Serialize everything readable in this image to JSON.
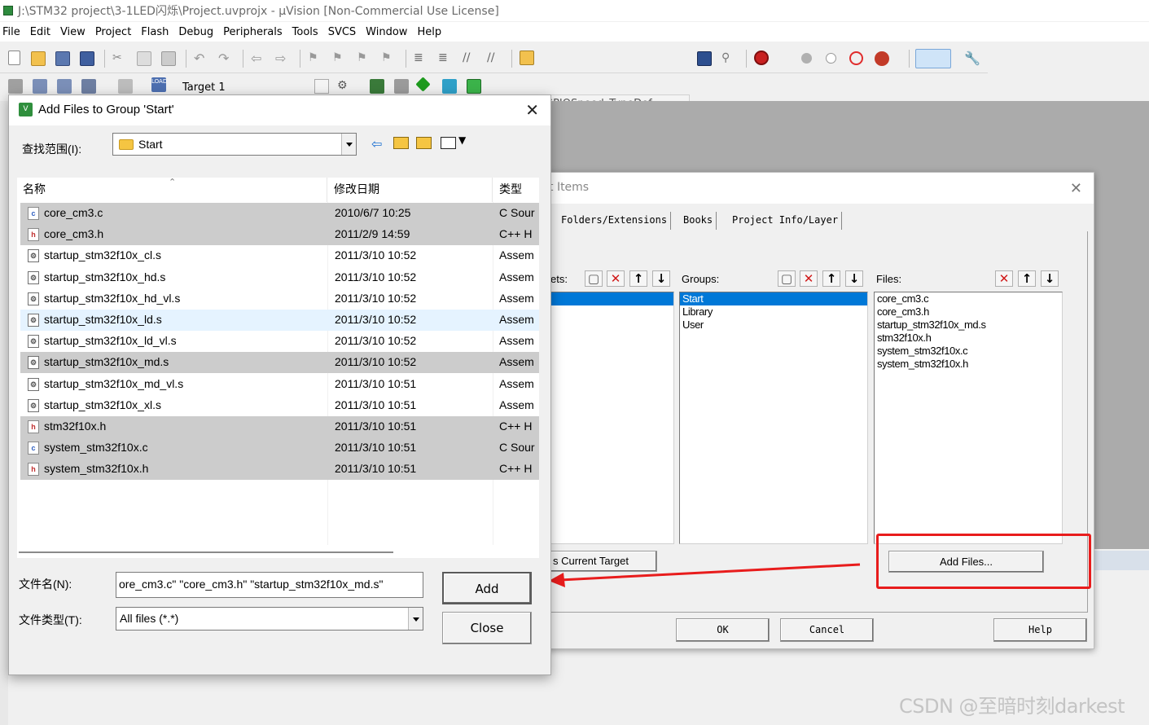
{
  "window": {
    "title": "J:\\STM32 project\\3-1LED闪烁\\Project.uvprojx - µVision  [Non-Commercial Use License]"
  },
  "menu": [
    "File",
    "Edit",
    "View",
    "Project",
    "Flash",
    "Debug",
    "Peripherals",
    "Tools",
    "SVCS",
    "Window",
    "Help"
  ],
  "toolbar": {
    "search_combo_value": "GPIOSpeed_TypeDef",
    "target_value": "Target 1"
  },
  "manage_dialog": {
    "title_fragment": "t Items",
    "tabs": [
      "Folders/Extensions",
      "Books",
      "Project Info/Layer"
    ],
    "targets_label": "ets:",
    "groups_label": "Groups:",
    "files_label": "Files:",
    "groups": [
      {
        "name": "Start",
        "selected": true
      },
      {
        "name": "Library",
        "selected": false
      },
      {
        "name": "User",
        "selected": false
      }
    ],
    "files": [
      "core_cm3.c",
      "core_cm3.h",
      "startup_stm32f10x_md.s",
      "stm32f10x.h",
      "system_stm32f10x.c",
      "system_stm32f10x.h"
    ],
    "set_current_target_label": "s Current Target",
    "add_files_label": "Add Files...",
    "ok_label": "OK",
    "cancel_label": "Cancel",
    "help_label": "Help",
    "highlight_color": "#e81c1c"
  },
  "add_dialog": {
    "title": "Add Files to Group 'Start'",
    "look_in_label": "查找范围(I):",
    "look_in_value": "Start",
    "columns": {
      "name": "名称",
      "date": "修改日期",
      "type": "类型"
    },
    "files": [
      {
        "name": "core_cm3.c",
        "date": "2010/6/7 10:25",
        "type": "C Sour",
        "icon": "c",
        "state": "selected"
      },
      {
        "name": "core_cm3.h",
        "date": "2011/2/9 14:59",
        "type": "C++ H",
        "icon": "h",
        "state": "selected"
      },
      {
        "name": "startup_stm32f10x_cl.s",
        "date": "2011/3/10 10:52",
        "type": "Assem",
        "icon": "asm",
        "state": "none"
      },
      {
        "name": "startup_stm32f10x_hd.s",
        "date": "2011/3/10 10:52",
        "type": "Assem",
        "icon": "asm",
        "state": "none"
      },
      {
        "name": "startup_stm32f10x_hd_vl.s",
        "date": "2011/3/10 10:52",
        "type": "Assem",
        "icon": "asm",
        "state": "none"
      },
      {
        "name": "startup_stm32f10x_ld.s",
        "date": "2011/3/10 10:52",
        "type": "Assem",
        "icon": "asm",
        "state": "hover"
      },
      {
        "name": "startup_stm32f10x_ld_vl.s",
        "date": "2011/3/10 10:52",
        "type": "Assem",
        "icon": "asm",
        "state": "none"
      },
      {
        "name": "startup_stm32f10x_md.s",
        "date": "2011/3/10 10:52",
        "type": "Assem",
        "icon": "asm",
        "state": "selected"
      },
      {
        "name": "startup_stm32f10x_md_vl.s",
        "date": "2011/3/10 10:51",
        "type": "Assem",
        "icon": "asm",
        "state": "none"
      },
      {
        "name": "startup_stm32f10x_xl.s",
        "date": "2011/3/10 10:51",
        "type": "Assem",
        "icon": "asm",
        "state": "none"
      },
      {
        "name": "stm32f10x.h",
        "date": "2011/3/10 10:51",
        "type": "C++ H",
        "icon": "h",
        "state": "selected"
      },
      {
        "name": "system_stm32f10x.c",
        "date": "2011/3/10 10:51",
        "type": "C Sour",
        "icon": "c",
        "state": "selected"
      },
      {
        "name": "system_stm32f10x.h",
        "date": "2011/3/10 10:51",
        "type": "C++ H",
        "icon": "h",
        "state": "selected"
      }
    ],
    "filename_label": "文件名(N):",
    "filename_value": "ore_cm3.c\" \"core_cm3.h\" \"startup_stm32f10x_md.s\"",
    "filetype_label": "文件类型(T):",
    "filetype_value": "All files (*.*)",
    "add_label": "Add",
    "close_label": "Close"
  },
  "watermark": "CSDN @至暗时刻darkest"
}
